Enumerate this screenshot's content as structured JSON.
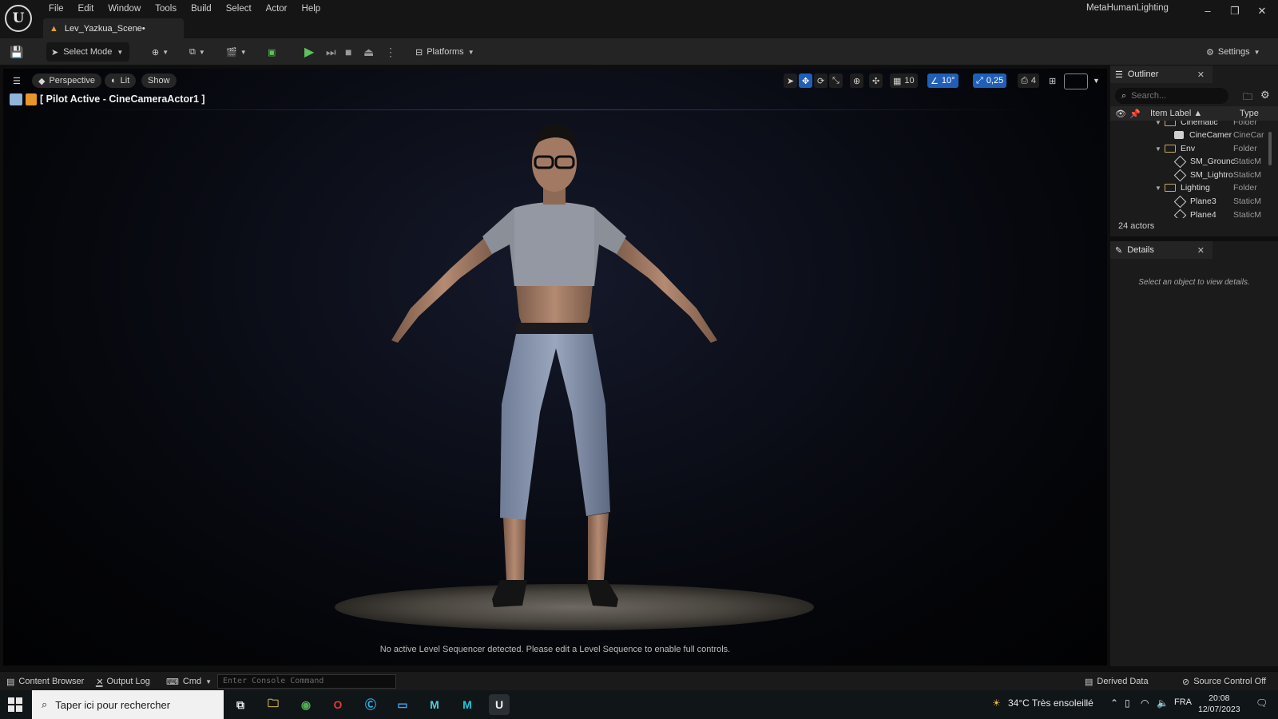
{
  "menu": [
    "File",
    "Edit",
    "Window",
    "Tools",
    "Build",
    "Select",
    "Actor",
    "Help"
  ],
  "project_name": "MetaHumanLighting",
  "document_tab": "Lev_Yazkua_Scene•",
  "toolbar": {
    "select_mode": "Select Mode",
    "platforms": "Platforms",
    "settings": "Settings"
  },
  "viewport": {
    "perspective": "Perspective",
    "lit": "Lit",
    "show": "Show",
    "pilot": "[ Pilot Active - CineCameraActor1 ]",
    "grid_snap": "10",
    "rotation_snap": "10°",
    "scale_snap": "0,25",
    "camera_speed": "4",
    "sequencer_message": "No active Level Sequencer detected. Please edit a Level Sequence to enable full controls."
  },
  "outliner": {
    "title": "Outliner",
    "search_placeholder": "Search...",
    "col_label": "Item Label ▲",
    "col_type": "Type",
    "rows": [
      {
        "name": "Cinematic",
        "type": "Folder",
        "kind": "folder"
      },
      {
        "name": "CineCamer",
        "type": "CineCar",
        "kind": "camera"
      },
      {
        "name": "Env",
        "type": "Folder",
        "kind": "folder"
      },
      {
        "name": "SM_Grounc",
        "type": "StaticM",
        "kind": "mesh"
      },
      {
        "name": "SM_Lightro",
        "type": "StaticM",
        "kind": "mesh"
      },
      {
        "name": "Lighting",
        "type": "Folder",
        "kind": "folder"
      },
      {
        "name": "Plane3",
        "type": "StaticM",
        "kind": "mesh"
      },
      {
        "name": "Plane4",
        "type": "StaticM",
        "kind": "mesh"
      }
    ],
    "actor_count": "24 actors"
  },
  "details": {
    "title": "Details",
    "hint": "Select an object to view details."
  },
  "statusbar": {
    "content_browser": "Content Browser",
    "output_log": "Output Log",
    "cmd": "Cmd",
    "console_placeholder": "Enter Console Command",
    "derived_data": "Derived Data",
    "source_control": "Source Control Off"
  },
  "taskbar": {
    "search_text": "Taper ici pour rechercher",
    "weather": "34°C  Très ensoleillé",
    "language": "FRA",
    "time": "20:08",
    "date": "12/07/2023"
  },
  "colors": {
    "accent_blue": "#1f5fb8",
    "play_green": "#5ec25a",
    "folder_gold": "#c9a865",
    "warning_orange": "#e8a020"
  }
}
